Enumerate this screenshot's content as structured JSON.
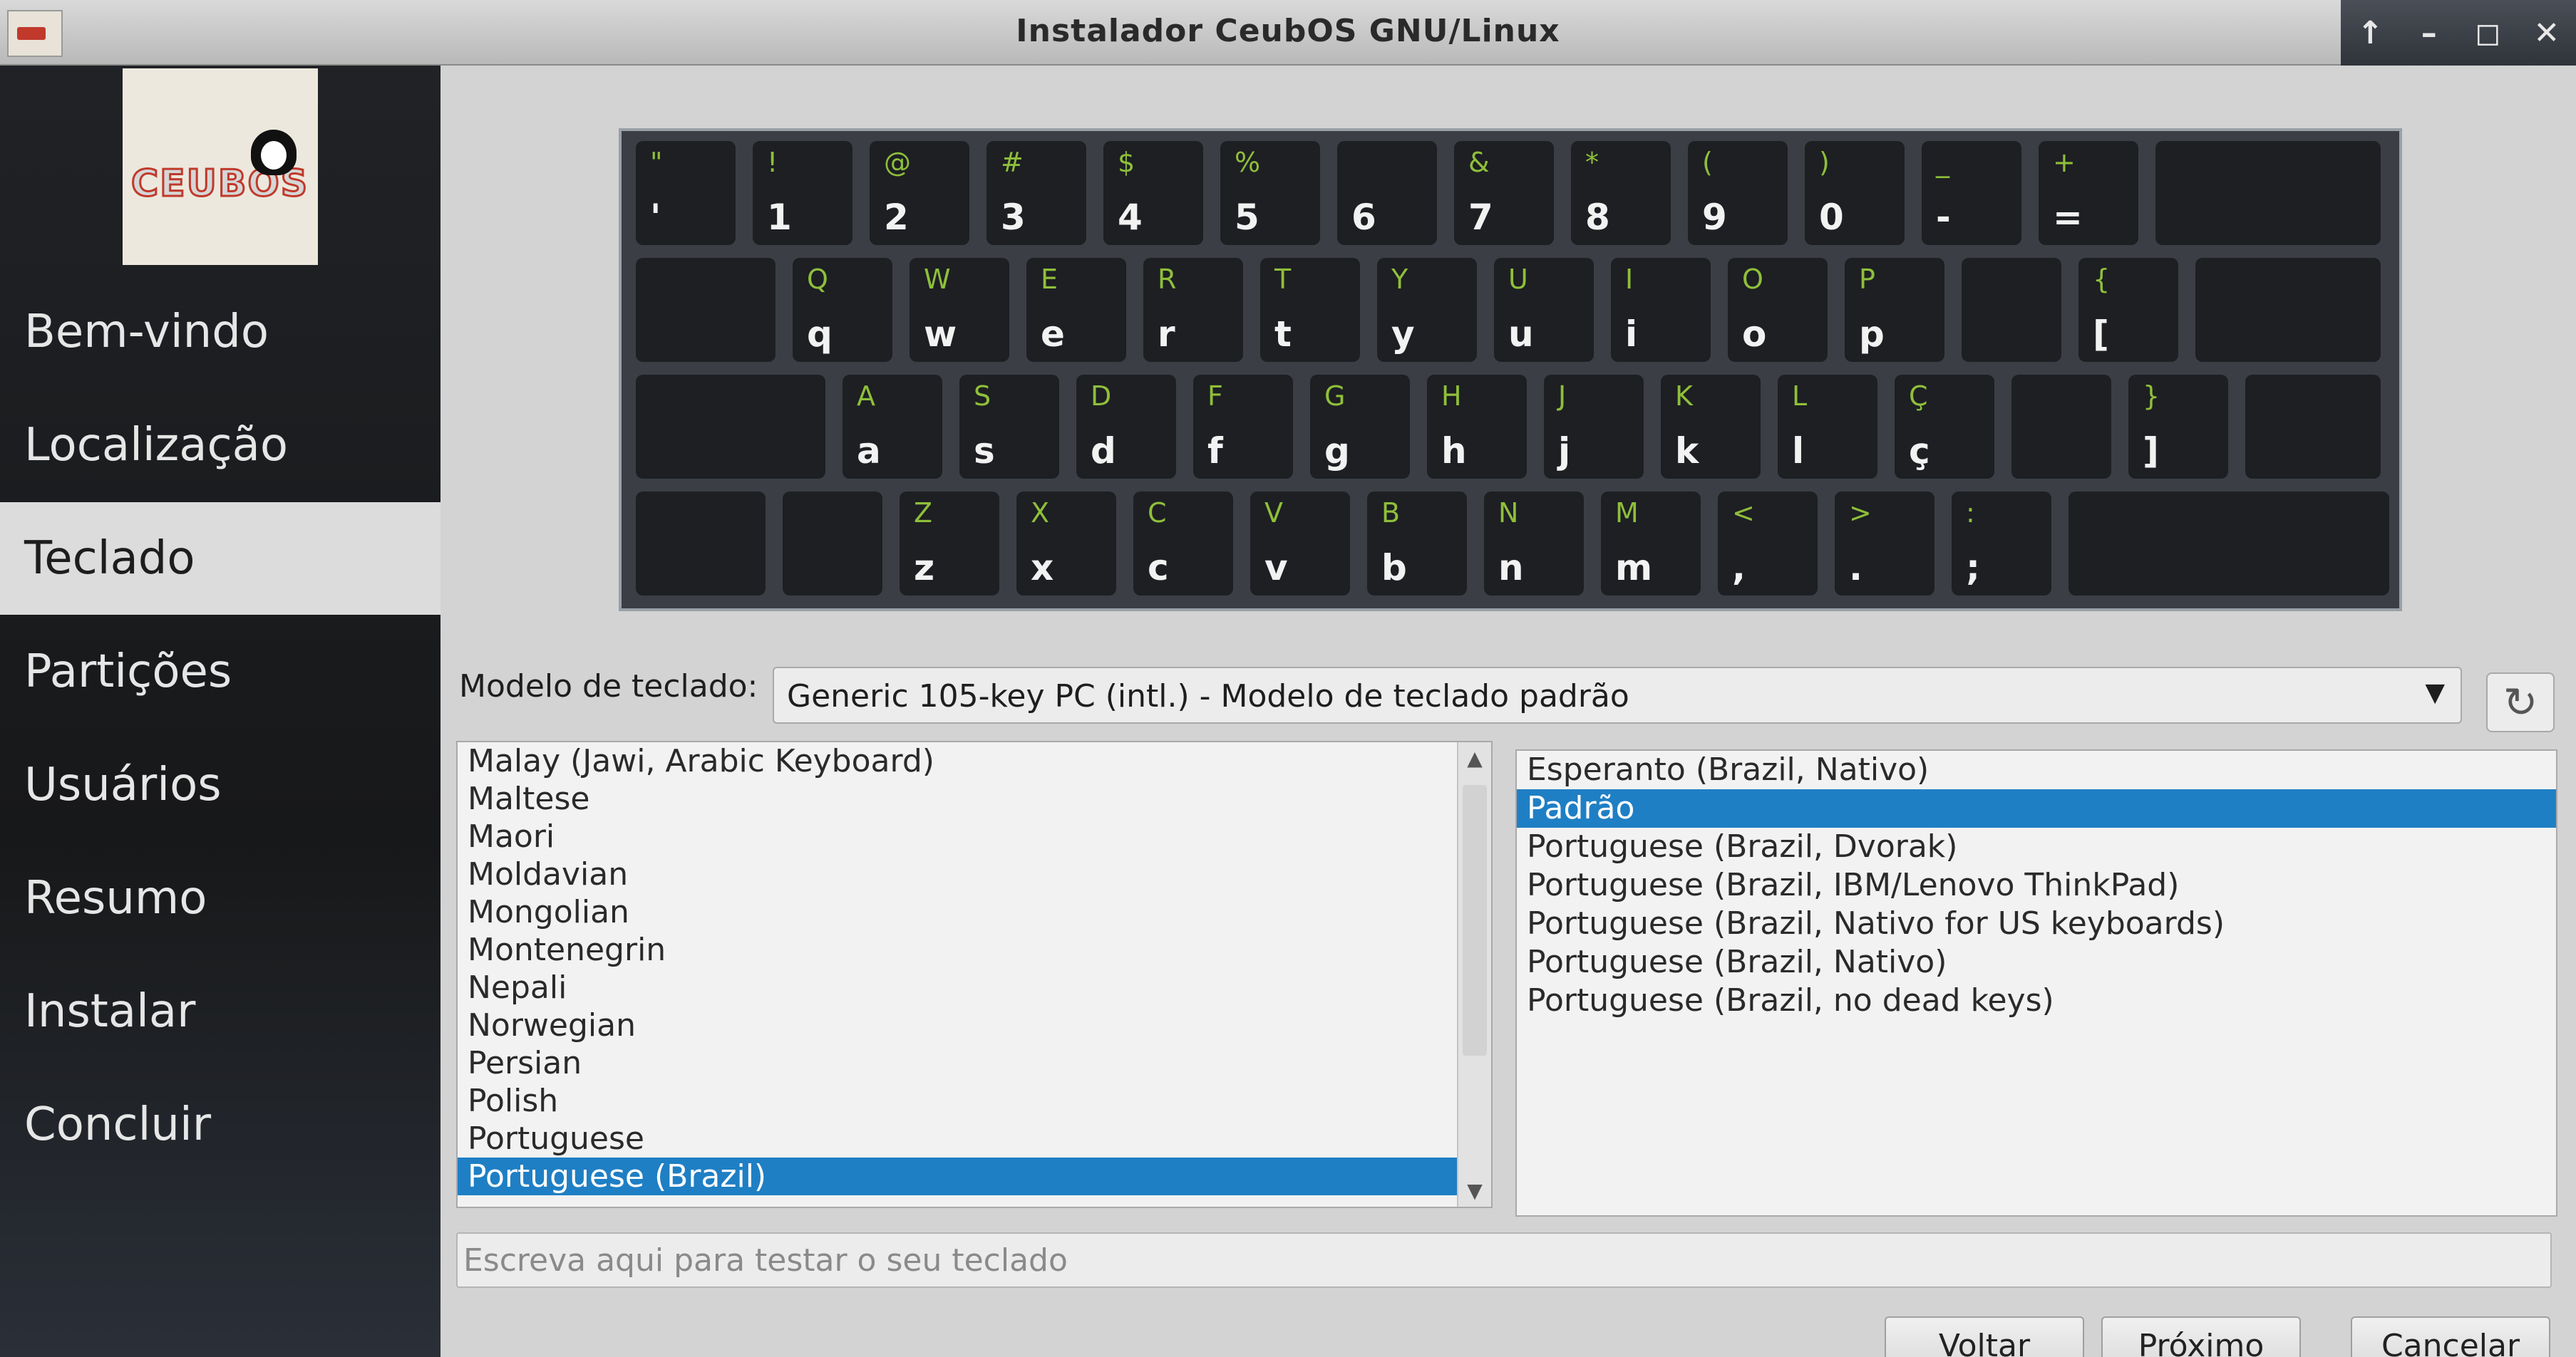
{
  "window": {
    "title": "Instalador CeubOS GNU/Linux",
    "controls": [
      "↑",
      "–",
      "◻",
      "✕"
    ]
  },
  "sidebar": {
    "logo_text": "CEUBOS",
    "items": [
      {
        "label": "Bem-vindo"
      },
      {
        "label": "Localização"
      },
      {
        "label": "Teclado",
        "active": true
      },
      {
        "label": "Partições"
      },
      {
        "label": "Usuários"
      },
      {
        "label": "Resumo"
      },
      {
        "label": "Instalar"
      },
      {
        "label": "Concluir"
      }
    ]
  },
  "keyboard": {
    "rows": [
      [
        [
          "\"",
          "'"
        ],
        [
          "!",
          "1"
        ],
        [
          "@",
          "2"
        ],
        [
          "#",
          "3"
        ],
        [
          "$",
          "4"
        ],
        [
          "%",
          "5"
        ],
        [
          "",
          "6"
        ],
        [
          "&",
          "7"
        ],
        [
          "*",
          "8"
        ],
        [
          "(",
          "9"
        ],
        [
          ")",
          "0"
        ],
        [
          "_",
          "-"
        ],
        [
          "+",
          "="
        ],
        [
          "",
          ""
        ]
      ],
      [
        [
          "",
          ""
        ],
        [
          "Q",
          "q"
        ],
        [
          "W",
          "w"
        ],
        [
          "E",
          "e"
        ],
        [
          "R",
          "r"
        ],
        [
          "T",
          "t"
        ],
        [
          "Y",
          "y"
        ],
        [
          "U",
          "u"
        ],
        [
          "I",
          "i"
        ],
        [
          "O",
          "o"
        ],
        [
          "P",
          "p"
        ],
        [
          "",
          ""
        ],
        [
          "{",
          "["
        ],
        [
          "",
          ""
        ]
      ],
      [
        [
          "",
          ""
        ],
        [
          "A",
          "a"
        ],
        [
          "S",
          "s"
        ],
        [
          "D",
          "d"
        ],
        [
          "F",
          "f"
        ],
        [
          "G",
          "g"
        ],
        [
          "H",
          "h"
        ],
        [
          "J",
          "j"
        ],
        [
          "K",
          "k"
        ],
        [
          "L",
          "l"
        ],
        [
          "Ç",
          "ç"
        ],
        [
          "",
          ""
        ],
        [
          "}",
          "]"
        ],
        [
          "",
          ""
        ]
      ],
      [
        [
          "",
          ""
        ],
        [
          "",
          ""
        ],
        [
          "Z",
          "z"
        ],
        [
          "X",
          "x"
        ],
        [
          "C",
          "c"
        ],
        [
          "V",
          "v"
        ],
        [
          "B",
          "b"
        ],
        [
          "N",
          "n"
        ],
        [
          "M",
          "m"
        ],
        [
          "<",
          ","
        ],
        [
          ">",
          "."
        ],
        [
          ":",
          ";"
        ],
        [
          "",
          ""
        ]
      ]
    ]
  },
  "model": {
    "label": "Modelo de teclado:",
    "value": "Generic 105-key PC (intl.)  -  Modelo de teclado padrão",
    "reset_icon": "↻"
  },
  "layouts": {
    "items": [
      "Malay (Jawi, Arabic Keyboard)",
      "Maltese",
      "Maori",
      "Moldavian",
      "Mongolian",
      "Montenegrin",
      "Nepali",
      "Norwegian",
      "Persian",
      "Polish",
      "Portuguese",
      "Portuguese (Brazil)"
    ],
    "selected": "Portuguese (Brazil)",
    "scroll_up": "▲",
    "scroll_down": "▼"
  },
  "variants": {
    "items": [
      "Esperanto (Brazil, Nativo)",
      "Padrão",
      "Portuguese (Brazil, Dvorak)",
      "Portuguese (Brazil, IBM/Lenovo ThinkPad)",
      "Portuguese (Brazil, Nativo for US keyboards)",
      "Portuguese (Brazil, Nativo)",
      "Portuguese (Brazil, no dead keys)"
    ],
    "selected": "Padrão"
  },
  "test_input": {
    "placeholder": "Escreva aqui para testar o seu teclado",
    "value": ""
  },
  "buttons": {
    "back": "Voltar",
    "next": "Próximo",
    "cancel": "Cancelar"
  }
}
